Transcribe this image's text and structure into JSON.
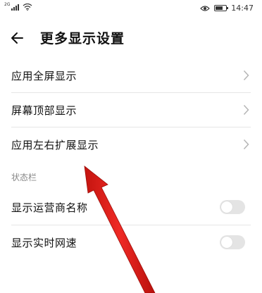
{
  "status_bar": {
    "signal_label": "2G",
    "time": "14:47"
  },
  "header": {
    "title": "更多显示设置",
    "back_icon": "arrow-left-icon"
  },
  "menu_items": [
    {
      "label": "应用全屏显示",
      "icon": "chevron-right-icon"
    },
    {
      "label": "屏幕顶部显示",
      "icon": "chevron-right-icon"
    },
    {
      "label": "应用左右扩展显示",
      "icon": "chevron-right-icon"
    }
  ],
  "status_section": {
    "title": "状态栏",
    "toggles": [
      {
        "label": "显示运营商名称",
        "enabled": false
      },
      {
        "label": "显示实时网速",
        "enabled": false
      }
    ]
  },
  "colors": {
    "annotation_arrow": "#e0201c",
    "toggle_off": "#e4e4e4"
  }
}
